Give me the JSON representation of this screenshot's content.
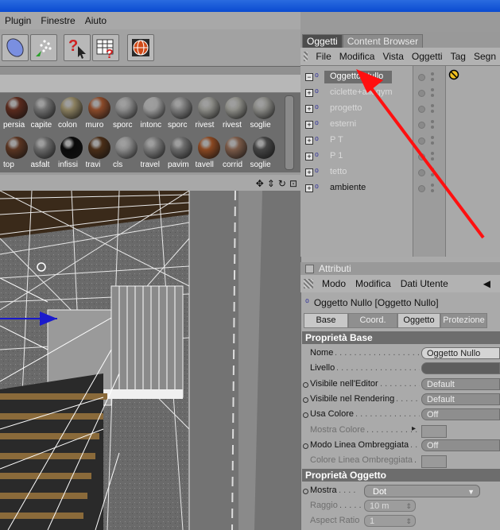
{
  "menubar": {
    "items": [
      "Plugin",
      "Finestre",
      "Aiuto"
    ]
  },
  "materials": [
    {
      "label": "persia",
      "color": "#5a2b1e"
    },
    {
      "label": "capite",
      "color": "#6f6f6f"
    },
    {
      "label": "colon",
      "color": "#8a7f5f"
    },
    {
      "label": "muro",
      "color": "#8a4a2a"
    },
    {
      "label": "sporc",
      "color": "#8c8c8c"
    },
    {
      "label": "intonc",
      "color": "#9a9a9a"
    },
    {
      "label": "sporc",
      "color": "#7d7d7d"
    },
    {
      "label": "rivest",
      "color": "#8b8b86"
    },
    {
      "label": "rivest",
      "color": "#8e8e88"
    },
    {
      "label": "soglie",
      "color": "#8a8a86"
    },
    {
      "label": "top",
      "color": "#5a3522"
    },
    {
      "label": "asfalt",
      "color": "#6a6a6a"
    },
    {
      "label": "infissi",
      "color": "#0a0a0a"
    },
    {
      "label": "travi",
      "color": "#4a2e18"
    },
    {
      "label": "cls",
      "color": "#8c8c8c"
    },
    {
      "label": "travel",
      "color": "#7a7a7a"
    },
    {
      "label": "pavim",
      "color": "#6b6b6b"
    },
    {
      "label": "tavell",
      "color": "#8a4822"
    },
    {
      "label": "corrid",
      "color": "#7a5a48"
    },
    {
      "label": "soglie",
      "color": "#444444"
    }
  ],
  "panel": {
    "tabs": [
      "Oggetti",
      "Content Browser"
    ],
    "menu": [
      "File",
      "Modifica",
      "Vista",
      "Oggetti",
      "Tag",
      "Segn"
    ]
  },
  "objects": [
    {
      "name": "Oggetto Nullo",
      "state": "sel",
      "expand": "−"
    },
    {
      "name": "ciclette+allogym",
      "state": "dim",
      "expand": "+"
    },
    {
      "name": "progetto",
      "state": "dim",
      "expand": "+"
    },
    {
      "name": "esterni",
      "state": "dim",
      "expand": "+"
    },
    {
      "name": "P T",
      "state": "dim",
      "expand": "+"
    },
    {
      "name": "P 1",
      "state": "dim",
      "expand": "+"
    },
    {
      "name": "tetto",
      "state": "dim",
      "expand": "+"
    },
    {
      "name": "ambiente",
      "state": "normal",
      "expand": "+"
    }
  ],
  "attributes": {
    "header": "Attributi",
    "menu": [
      "Modo",
      "Modifica",
      "Dati Utente"
    ],
    "object_title": "Oggetto Nullo [Oggetto Nullo]",
    "tabs": [
      "Base",
      "Coord.",
      "Oggetto",
      "Protezione"
    ],
    "base_section": "Proprietà Base",
    "base_props": [
      {
        "label": "Nome",
        "value": "Oggetto Nullo",
        "kind": "light",
        "dim": false,
        "bullet": false
      },
      {
        "label": "Livello",
        "value": "",
        "kind": "dark",
        "dim": false,
        "bullet": false
      },
      {
        "label": "Visibile nell'Editor",
        "value": "Default",
        "kind": "drop",
        "dim": false,
        "bullet": true
      },
      {
        "label": "Visibile nel Rendering",
        "value": "Default",
        "kind": "drop",
        "dim": false,
        "bullet": true
      },
      {
        "label": "Usa Colore",
        "value": "Off",
        "kind": "drop",
        "dim": false,
        "bullet": true
      },
      {
        "label": "Mostra Colore",
        "value": "",
        "kind": "box",
        "dim": true,
        "bullet": false
      },
      {
        "label": "Modo Linea Ombreggiata",
        "value": "Off",
        "kind": "drop",
        "dim": false,
        "bullet": true
      },
      {
        "label": "Colore Linea Ombreggiata",
        "value": "",
        "kind": "box",
        "dim": true,
        "bullet": false
      }
    ],
    "object_section": "Proprietà Oggetto",
    "object_props": [
      {
        "label": "Mostra",
        "value": "Dot",
        "kind": "select",
        "dim": false,
        "bullet": true
      },
      {
        "label": "Raggio",
        "value": "10 m",
        "kind": "num",
        "dim": true,
        "bullet": false
      },
      {
        "label": "Aspect Ratio",
        "value": "1",
        "kind": "num",
        "dim": true,
        "bullet": false
      }
    ]
  }
}
